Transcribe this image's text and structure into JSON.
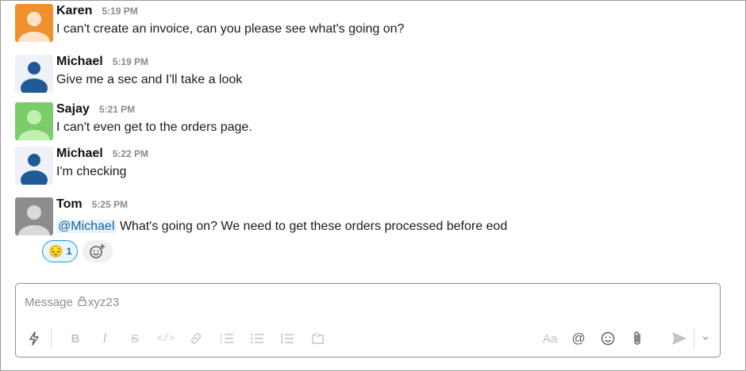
{
  "messages": [
    {
      "name": "Karen",
      "time": "5:19 PM",
      "text": "I can't create an invoice, can you please see what's going on?"
    },
    {
      "name": "Michael",
      "time": "5:19 PM",
      "text": "Give me a sec and I'll take a look"
    },
    {
      "name": "Sajay",
      "time": "5:21 PM",
      "text": "I can't even get to the orders page."
    },
    {
      "name": "Michael",
      "time": "5:22 PM",
      "text": "I'm checking"
    },
    {
      "name": "Tom",
      "time": "5:25 PM",
      "mention": "@Michael",
      "text": " What's going on? We need to get these orders processed before eod"
    }
  ],
  "reactions": [
    {
      "emoji": "😔",
      "count": "1"
    }
  ],
  "avatar_colors": {
    "karen": "#f0912f",
    "michael": "#1f5996",
    "sajay": "#7ccc6c",
    "tom": "#8d8d8d"
  },
  "composer": {
    "placeholder": "Message",
    "channel": "xyz23",
    "toolbar_icons": [
      "shortcuts-icon",
      "bold-icon",
      "italic-icon",
      "strikethrough-icon",
      "code-icon",
      "link-icon",
      "ordered-list-icon",
      "bulleted-list-icon",
      "blockquote-icon",
      "code-block-icon",
      "formatting-icon",
      "mention-icon",
      "emoji-icon",
      "attachment-icon",
      "send-icon",
      "send-options-icon"
    ],
    "formatting_label": "Aa"
  }
}
